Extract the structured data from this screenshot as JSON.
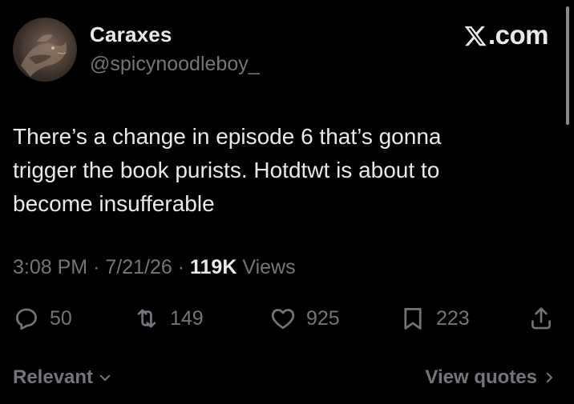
{
  "header": {
    "display_name": "Caraxes",
    "handle": "@spicynoodleboy_",
    "brand": ".com"
  },
  "tweet": {
    "lines": [
      "There’s a change in episode 6 that’s gonna",
      "trigger the book purists. Hotdtwt is about to",
      "become insufferable"
    ],
    "time": "3:08 PM",
    "date": "7/21/26",
    "views_count": "119K",
    "views_label": "Views",
    "separator": "·"
  },
  "actions": {
    "replies": "50",
    "reposts": "149",
    "likes": "925",
    "bookmarks": "223"
  },
  "icons": [
    "reply-icon",
    "repost-icon",
    "like-icon",
    "bookmark-icon",
    "share-icon",
    "x-logo-icon",
    "chevron-down-icon",
    "chevron-right-icon"
  ],
  "footer": {
    "sort_label": "Relevant",
    "view_quotes_label": "View quotes"
  },
  "colors": {
    "background": "#000000",
    "primary_text": "#e7e9ea",
    "secondary_text": "#71767b"
  }
}
